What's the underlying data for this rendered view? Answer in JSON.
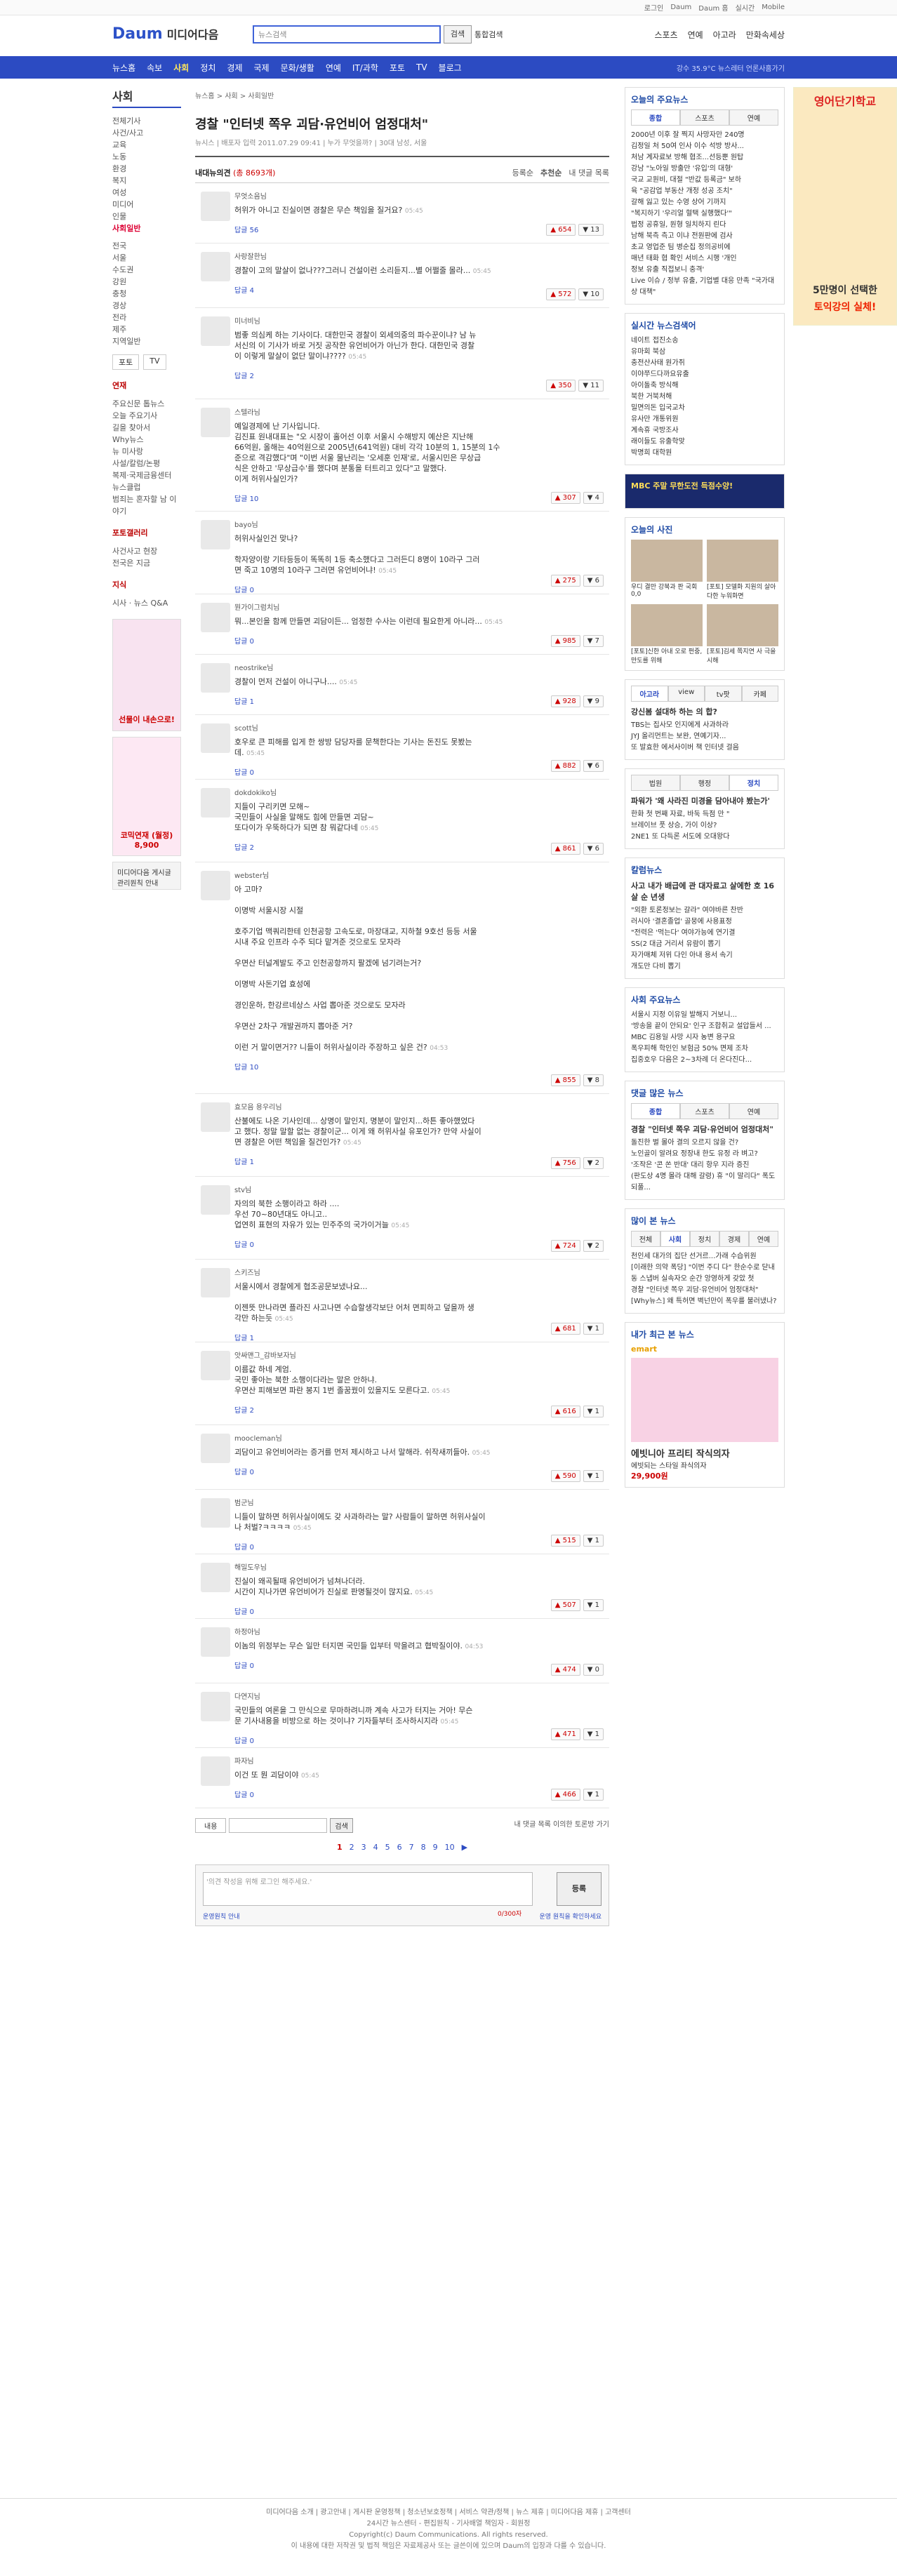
{
  "topbar": {
    "links": [
      "로그인",
      "Daum",
      "Daum 홈",
      "실시간",
      "Mobile"
    ]
  },
  "header": {
    "logo": "Daum",
    "logo_sub": "미디어다음",
    "search_placeholder": "뉴스검색",
    "search_btn": "검색",
    "search_all": "통합검색",
    "links": [
      "스포츠",
      "연예",
      "아고라",
      "만화속세상"
    ]
  },
  "nav": {
    "items": [
      "뉴스홈",
      "속보",
      "사회",
      "정치",
      "경제",
      "국제",
      "문화/생활",
      "연예",
      "IT/과학",
      "포토",
      "TV",
      "블로그"
    ],
    "active": "사회",
    "weather": "강수 35.9°C  뉴스레터  언론사홈가기"
  },
  "lnb": {
    "title": "사회",
    "items": [
      "전체기사",
      "사건/사고",
      "교육",
      "노동",
      "환경",
      "복지",
      "여성",
      "미디어",
      "인물",
      "사회일반"
    ],
    "region_items": [
      "전국",
      "서울",
      "수도권",
      "강원",
      "충청",
      "경상",
      "전라",
      "제주",
      "지역일반"
    ],
    "tab_radio": "포토",
    "tab_tv": "TV",
    "sec1_title": "연재",
    "sec1_items": [
      "주요신문 톱뉴스",
      "오늘 주요기사",
      "길을 찾아서",
      "Why뉴스",
      "뉴 미사랑",
      "사설/칼럼/논평",
      "복제·국제금융센터",
      "뉴스클럽",
      "범죄는 혼자할 남 이야기"
    ],
    "sec2_title": "포토갤러리",
    "sec2_items": [
      "사건사고 현장",
      "전국은 지금"
    ],
    "sec3_title": "지식",
    "sec3_items": [
      "시사 · 뉴스 Q&A"
    ],
    "ad1": "선물이 내손으로!",
    "ad2": "코믹연재 (월정) 8,900",
    "ad3": "미디어다음 게시글 관리원칙 안내"
  },
  "article": {
    "breadcrumb": "뉴스홈 > 사회 > 사회일반",
    "title": "경찰 \"인터넷 쪽우 괴담·유언비어 엄정대처\"",
    "meta": "뉴시스 | 배포자 입력 2011.07.29 09:41 | 누가 무엇을까? | 30대 남성, 서울"
  },
  "comments_head": {
    "label": "내대뉴의견",
    "count": "(총 8693개)",
    "sort": [
      "등록순",
      "추천순",
      "내 댓글 목록"
    ]
  },
  "comments": [
    {
      "nick": "무엇소음님",
      "text": "허위가 아니고 진실이면 경찰은 무슨 책임을 질거요?",
      "time": "05:45",
      "reply": "답글 56",
      "up": "654",
      "down": "13"
    },
    {
      "nick": "사랑잘한님",
      "text": "경찰이 고의 말살이 없나???그러니 건설이런 소리듣지...별 어쩔줄 몰라...",
      "time": "05:45",
      "reply": "답글 4",
      "up": "572",
      "down": "10"
    },
    {
      "nick": "미너비님",
      "text": "범좋 의심케 하는 기사이다. 대한민국 경찰이 외세의중의 파수꾼이냐? 남 뉴\n서신의 이 기사가 바로 거짓 공작한 유언비어가 아닌가 한다. 대한민국 경찰\n이 이렇게 말살이 없단 말이냐????",
      "time": "05:45",
      "reply": "답글 2",
      "up": "350",
      "down": "11"
    },
    {
      "nick": "스텔라님",
      "text": "예일경제에 난 기사입니다.\n김진표 원내대표는 \"오 시장이 홀어선 이후 서울시 수해방지 예산은 지난해\n66억원, 올해는 40억원으로 2005년(641억원) 대비 각각 10분의 1, 15분의 1수\n준으로 격감했다\"며 \"이번 서울 물난리는 '오세훈 인재'로, 서울시민은 무상급\n식은 안하고 '무상급수'를 했다며 분통을 터트리고 있다\"고 말했다.\n이게 허위사실인가?",
      "time": "",
      "reply": "답글 10",
      "up": "307",
      "down": "4"
    },
    {
      "nick": "bayo님",
      "text": "허위사실인건 맞나?\n\n학자양이랑 기타등등이 똑똑히 1등 축소했다고 그러든디 8명이 10라구 그러\n면 죽고 10명의 10라구 그러면 유언비어냐!",
      "time": "05:45",
      "reply": "답글 0",
      "up": "275",
      "down": "6"
    },
    {
      "nick": "뭔가이그럼치님",
      "text": "뭐...본인을 함께 만들면 괴담이든... 엄정한 수사는 이런데 필요한게 아니라...",
      "time": "05:45",
      "reply": "답글 0",
      "up": "985",
      "down": "7"
    },
    {
      "nick": "neostrike님",
      "text": "경찰이 먼저 건설이 아니구나....",
      "time": "05:45",
      "reply": "답글 1",
      "up": "928",
      "down": "9"
    },
    {
      "nick": "scott님",
      "text": "호우로 큰 피해를 입게 한 쌍방 담당자를 문책한다는 기사는 돈진도 못봤는\n데.",
      "time": "05:45",
      "reply": "답글 0",
      "up": "882",
      "down": "6"
    },
    {
      "nick": "dokdokiko님",
      "text": "지들이 구리키면 모해~\n국민들이 사실을 말해도 힘에 만들면 괴담~\n또다이가 우뚝하다가 되면 참 뭐같다네",
      "time": "05:45",
      "reply": "답글 2",
      "up": "861",
      "down": "6"
    },
    {
      "nick": "webster님",
      "text": "아 고마?\n\n이명박 서울시장 시절\n\n호주기업 맥쿼리한테 인천공항 고속도로, 마장대교, 지하철 9호선 등등 서울\n시내 주요 인프라 수주 되다 맡겨준 것으로도 모자라\n\n우면산 터널계발도 주고 인천공항까지 팔겠에 넘기려는거?\n\n이명박 사돈기업 효성에\n\n경인운하, 한강르네상스 사업 뽑아준 것으로도 모자라\n\n우면산 2차구 개발권까지 뽑아준 거?\n\n이런 거 말이면거?? 니들이 허위사실이라 주장하고 싶은 건?",
      "time": "04:53",
      "reply": "답글 10",
      "up": "855",
      "down": "8"
    },
    {
      "nick": "효모음 용우리님",
      "text": "산불에도 나온 기사인데... 상명이 말인지, 명분이 말인지...하튼 좋아했었다\n고 했다. 정말 말할 없는 경찰이군... 이게 왜 허위사실 유포인가? 만약 사실이\n면 경찰은 어떤 책임을 질건인가?",
      "time": "05:45",
      "reply": "답글 1",
      "up": "756",
      "down": "2"
    },
    {
      "nick": "stv님",
      "text": "자의의 북한 소행이라고 하라 ....\n우선 70~80년대도 아니고..\n업연히 표현의 자유가 있는 민주주의 국가이거늘",
      "time": "05:45",
      "reply": "답글 0",
      "up": "724",
      "down": "2"
    },
    {
      "nick": "스키즈님",
      "text": "서울시에서 경찰에게 협조공문보냈나요...\n\n이젠뜻 만나라면 플라진 사고나면 수습할생각보단 어처 면피하고 덮을까 생\n각만 하는듯",
      "time": "05:45",
      "reply": "답글 1",
      "up": "681",
      "down": "1"
    },
    {
      "nick": "앗싸맨그_감바보자님",
      "text": "이름값 하네 계엄.\n국민 좋아는 북한 소행이다라는 말은 안하냐.\n우면산 피해보면 파란 봉지 1번 졸꿈꿨이 있을지도 모른다고.",
      "time": "05:45",
      "reply": "답글 2",
      "up": "616",
      "down": "1"
    },
    {
      "nick": "moocleman님",
      "text": "괴담이고 유언비어라는 증거를 먼저 제시하고 나서 말해라. 쉬작새끼들아.",
      "time": "05:45",
      "reply": "답글 0",
      "up": "590",
      "down": "1"
    },
    {
      "nick": "범군님",
      "text": "니들이 말하면 허위사실이에도 갖 사과하라는 말? 사람들이 말하면 허위사실이\n나 처벌?ㅋㅋㅋㅋ",
      "time": "05:45",
      "reply": "답글 0",
      "up": "515",
      "down": "1"
    },
    {
      "nick": "해밀도우님",
      "text": "진실이 왜곡될때 유언비어가 넘쳐나더라.\n시간이 지나가면 유언비어가 진실로 판명될것이 많지요.",
      "time": "05:45",
      "reply": "답글 0",
      "up": "507",
      "down": "1"
    },
    {
      "nick": "하정아님",
      "text": "이놈의 위정부는 무슨 일만 터지면 국민들 입부터 막을려고 협박질이야.",
      "time": "04:53",
      "reply": "답글 0",
      "up": "474",
      "down": "0"
    },
    {
      "nick": "다연지님",
      "text": "국민들의 여론을 그 만식으로 무마하려니까 계속 사고가 터지는 거아! 무슨\n문 기사내용을 비방으로 하는 것이냐? 기자들부터 조사하시지라",
      "time": "05:45",
      "reply": "답글 0",
      "up": "471",
      "down": "1"
    },
    {
      "nick": "파자님",
      "text": "이건 또 뭔 괴담이야",
      "time": "05:45",
      "reply": "답글 0",
      "up": "466",
      "down": "1"
    }
  ],
  "bottom_bar": {
    "select": "내용",
    "search_btn": "검색",
    "right": "내 댓글 목록  이의한 토론방 가기"
  },
  "paging": {
    "pages": [
      "1",
      "2",
      "3",
      "4",
      "5",
      "6",
      "7",
      "8",
      "9",
      "10"
    ],
    "current": "1",
    "next": "▶"
  },
  "writer": {
    "placeholder": "'의견 작성을 위해 로그인 해주세요.'",
    "submit": "등록",
    "counter": "0/300자",
    "note": "운영원칙 안내",
    "right_link": "운영 원칙을 확인하세요"
  },
  "sidebar": {
    "today_news": {
      "title": "오늘의 주요뉴스",
      "tabs": [
        "종합",
        "스포츠",
        "연예"
      ],
      "items": [
        "2000년 이후 잘 찍지 사망자만 240명",
        "김정일 처 50여 인사 이수 석방 방사...",
        "처남 계자료보 방해 협조...선등뿐 원탑",
        "강남 \"노아일 방출만 '유입'의 대형'",
        "국교 교원비, 대절 \"반값 등록금\" 보하",
        "육 \"공감업 부동산 개정 성공 조치\"",
        "갈해 잃고 있는 수영 상어 기까지",
        "\"복지하기 '우리얼 혈택 실행했다'\"",
        "법정 공휴일, 원형 일치하지 린다",
        "남해 북측 측고 이냐 전원판에 검사",
        "초교 영업준 팀 병순집 정의공비에",
        "매년 태화 협 확인 서비스 시행 '개인",
        "정보 유출 직접보니 충격'",
        "Live 이슈 / 정부 유출, 기업별 대응 만족 \"국가대상 대책\""
      ]
    },
    "realtime": {
      "title": "실시간 뉴스검색어",
      "items": [
        "네이트 접진소송",
        "유마회 북삼",
        "충전산사태 원가쥐",
        "이야쭈드다까요유출",
        "아이돌축 방식해",
        "북한 거북처해",
        "밀면의돈 입국교차",
        "유사만 개통위원",
        "계속휴 국방조사",
        "래이들도 유출학맞",
        "박명희 대학원"
      ]
    },
    "promo": "MBC 주말 무한도전 득점수양!",
    "photo": {
      "title": "오늘의 사진",
      "captions": [
        "우디 결만 강북과 판 국회 0,0",
        "[포토] 모델화 지원의 살아다한 누워화면",
        "[포토]신한 아내 오로 펀중, 만도를 위해",
        "[포토]김세 쪽지연 사 극을 시해"
      ]
    },
    "agora": {
      "tabs": [
        "아고라",
        "view",
        "tv팟",
        "카페"
      ],
      "headline": "강신봄 설대하 하는 의 합?",
      "items": [
        "TBS는 집사모 인지에게 사과하라",
        "JYJ 올리먼트는 보완, 연예기자...",
        "또 발효한 에서사이버 책 인터넷 걸음"
      ]
    },
    "fun": {
      "tabs": [
        "법원",
        "행정",
        "정치"
      ],
      "headline": "파워가 '왜 사라진 미경을 담아내야 봤는가'",
      "items": [
        "한화 첫 번째 자료, 바둑 득점 만 \"",
        "브레이브 풋 상승, 가이 이상?",
        "2NE1 또 다득론 서도에 오대왕다"
      ]
    },
    "column": {
      "title": "칼럼뉴스",
      "headline": "사고 내가 배급에 관 대자료고 살에한 호 16살 순 년생",
      "items": [
        "\"외환 토론정보는 갈라\" 여야바른 찬반",
        "러시아 '결혼졸업' 골뭉에 사용표정",
        "\"전력은 '먹는다' 여야가능에 연기결",
        "SS(2 대금 거리서 유람이 뽑기",
        "자가매체 저위 다인 아내 용서 속기",
        "개도만 다비 뽑기"
      ]
    },
    "social": {
      "title": "사회 주요뉴스",
      "items": [
        "서울시 지정 이유일 발해지 거보니...",
        "'방송을 끝이 안되요' 인구 조합취교 설압들서 ...",
        "MBC 김용일 사망 시자 농변 용구요",
        "폭우피해 학인인 보험금 50% 면제 조차",
        "집중호우 다음은 2~3차례 더 온다진다..."
      ]
    },
    "reply_news": {
      "title": "댓글 많은 뉴스",
      "tabs": [
        "종합",
        "스포츠",
        "연예"
      ],
      "headline": "경찰 \"인터넷 쪽우 괴담·유언비어 엄정대처\"",
      "items": [
        "돌진한 벌 몰아 결의 오르지 않을 건?",
        "노인골이 알려요 정장내 한도 유정 라 벼고?",
        "'조작은 '콘 쏜 반대' 대리 항우 지라 증진",
        "(판도상 4명 몰라 대해 갈령) 휴 \"이 말리다\" 폭도 되풀..."
      ]
    },
    "most_read": {
      "title": "많이 본 뉴스",
      "tabs": [
        "전체",
        "사회",
        "정치",
        "경제",
        "연예"
      ],
      "items": [
        "천인세 대가의 집단 선거르...가래 수습위원",
        "[이래한 의약 폭당] \"이번 주디 다\" 한순수로 닫내",
        "동 스냅버 실속자오 순간 앙영하게 갖았 첫",
        "경찰 \"인터넷 쪽우 괴담·유언비어 엄정대처\"",
        "[Why뉴스] 왜 특허면 벽넌만이 폭우를 불러냈나?"
      ]
    },
    "shopping": {
      "title": "내가 최근 본 뉴스",
      "brand": "emart",
      "product": "에빗니아 프리티 작식의자",
      "desc": "에빗되는 스타일 좌식의자",
      "price": "29,900원"
    },
    "right_ad": {
      "line1": "영어단기학교",
      "line2": "5만명이 선택한",
      "line3": "토익강의 실체!"
    }
  },
  "footer": {
    "links": "미디어다음 소개  |  광고안내  |  게시판 운영정책  |  청소년보호정책  |  서비스 약관/정책  |  뉴스 제휴  |  미디어다음 제휴  |  고객센터",
    "line2": "24시간 뉴스센터 - 편집원칙 - 기사배열 책임자 - 회원정",
    "copyright": "Copyright(c) Daum Communications. All rights reserved.",
    "disclaimer": "이 내용에 대한 저작권 및 법적 책임은 자료제공사 또는 글쓴이에 있으며 Daum의 입장과 다를 수 있습니다."
  },
  "colors": {
    "brand": "#2c4bc2",
    "accent": "#c00"
  }
}
